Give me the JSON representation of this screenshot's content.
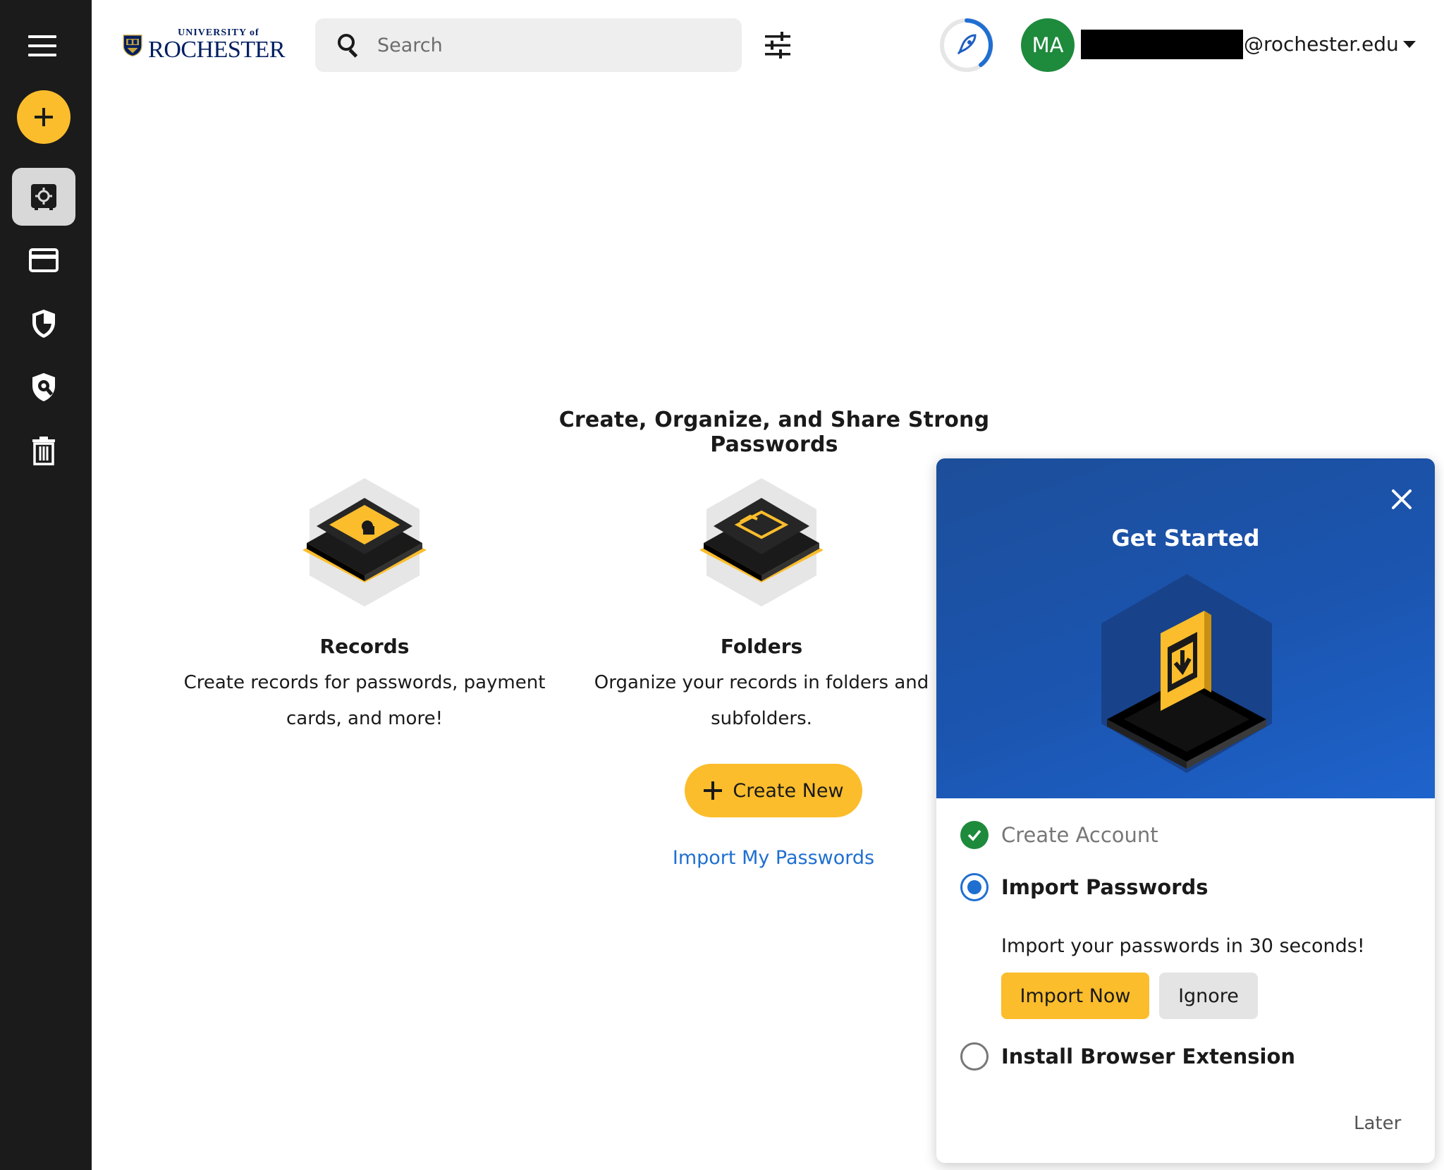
{
  "sidebar": {
    "menu_icon": "hamburger-menu-icon",
    "add_icon": "plus-icon",
    "items": [
      {
        "icon": "vault-icon",
        "active": true
      },
      {
        "icon": "payment-card-icon",
        "active": false
      },
      {
        "icon": "shield-icon",
        "active": false
      },
      {
        "icon": "breachwatch-icon",
        "active": false
      },
      {
        "icon": "trash-icon",
        "active": false
      }
    ]
  },
  "header": {
    "logo_small": "UNIVERSITY of",
    "logo_big": "ROCHESTER",
    "search_placeholder": "Search",
    "avatar_initials": "MA",
    "email_domain": "@rochester.edu"
  },
  "main": {
    "headline": "Create, Organize, and Share Strong Passwords",
    "features": [
      {
        "title": "Records",
        "description": "Create records for passwords, payment cards, and more!"
      },
      {
        "title": "Folders",
        "description": "Organize your records in folders and subfolders."
      }
    ],
    "create_new_label": "Create New",
    "import_link": "Import My Passwords"
  },
  "get_started": {
    "title": "Get Started",
    "steps": [
      {
        "label": "Create Account",
        "status": "done"
      },
      {
        "label": "Import Passwords",
        "status": "current",
        "description": "Import your passwords in 30 seconds!"
      },
      {
        "label": "Install Browser Extension",
        "status": "todo"
      }
    ],
    "import_now_label": "Import Now",
    "ignore_label": "Ignore",
    "later_label": "Later"
  },
  "colors": {
    "accent_yellow": "#fbbd2c",
    "link_blue": "#1f6fd1",
    "success_green": "#1e8a3c",
    "rail_dark": "#1b1b1b",
    "panel_blue": "#1b55b0"
  }
}
